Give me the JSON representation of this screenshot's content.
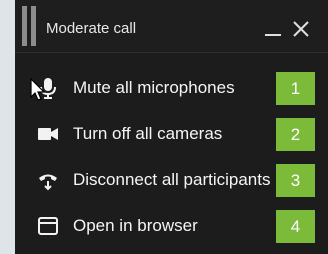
{
  "window": {
    "title": "Moderate call"
  },
  "menu": {
    "items": [
      {
        "icon": "microphone-icon",
        "label": "Mute all microphones",
        "badge": "1"
      },
      {
        "icon": "camera-icon",
        "label": "Turn off all cameras",
        "badge": "2"
      },
      {
        "icon": "disconnect-icon",
        "label": "Disconnect all participants",
        "badge": "3"
      },
      {
        "icon": "browser-window-icon",
        "label": "Open in browser",
        "badge": "4"
      }
    ]
  },
  "colors": {
    "background": "#1c1c1c",
    "text": "#f5f5f5",
    "badge": "#7cba3a"
  }
}
